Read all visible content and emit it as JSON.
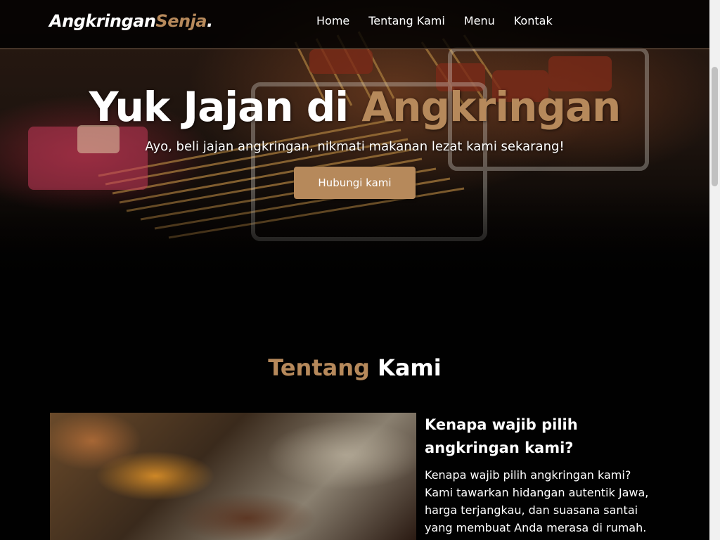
{
  "navbar": {
    "logo_main": "Angkringan",
    "logo_accent": "Senja",
    "logo_dot": ".",
    "links": [
      "Home",
      "Tentang Kami",
      "Menu",
      "Kontak"
    ]
  },
  "hero": {
    "title_main": "Yuk Jajan di ",
    "title_accent": "Angkringan",
    "subtitle": "Ayo, beli jajan angkringan, nikmati makanan lezat kami sekarang!",
    "cta_label": "Hubungi kami"
  },
  "about": {
    "title_accent": "Tentang",
    "title_main": " Kami",
    "heading": "Kenapa wajib pilih angkringan kami?",
    "text": "Kenapa wajib pilih angkringan kami? Kami tawarkan hidangan autentik Jawa, harga terjangkau, dan suasana santai yang membuat Anda merasa di rumah."
  },
  "colors": {
    "accent": "#b6895b",
    "background": "#010101"
  }
}
